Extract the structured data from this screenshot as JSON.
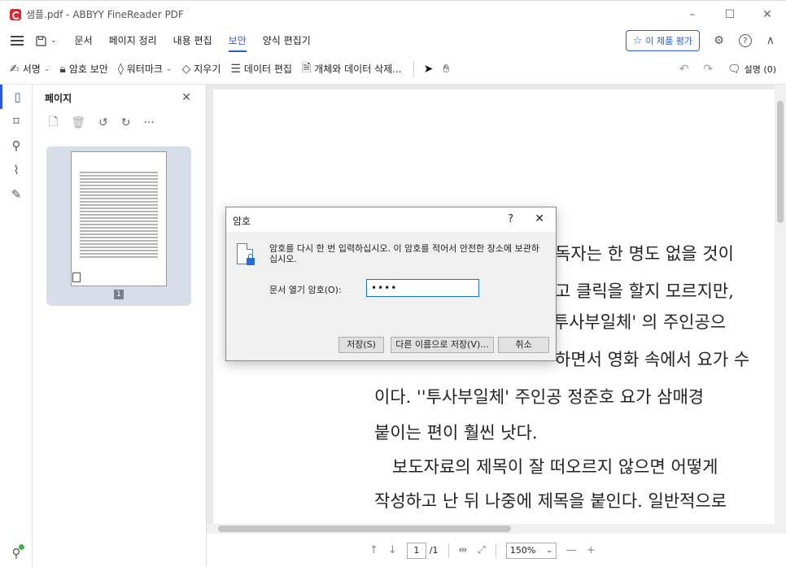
{
  "window": {
    "title": "샘플.pdf - ABBYY FineReader PDF",
    "minimize": "–",
    "maximize": "☐",
    "close": "✕"
  },
  "menu": {
    "file_icon": "save-icon",
    "tabs": [
      "문서",
      "페이지 정리",
      "내용 편집",
      "보안",
      "양식 편집기"
    ],
    "active_tab": "보안",
    "rate_label": "이 제품 평가",
    "settings_glyph": "⚙",
    "help_glyph": "?",
    "collapse_glyph": "∧"
  },
  "toolbar": {
    "signature": "서명",
    "password_security": "암호 보안",
    "watermark": "워터마크",
    "erase": "지우기",
    "redact_data": "데이터 편집",
    "delete_objects": "개체와 데이터 삭제...",
    "notes": "설명 (0)"
  },
  "pages_panel": {
    "title": "페이지",
    "page_number": "1"
  },
  "document": {
    "lines": [
      "독자는 한 명도 없을 것이",
      "고 클릭을 할지 모르지만,",
      "'투사부일체' 의 주인공으",
      "하면서 영화 속에서 요가 수",
      "이다. ''투사부일체' 주인공 정준호 요가 삼매경",
      "붙이는 편이 훨씬 낫다.",
      "보도자료의 제목이 잘 떠오르지 않으면 어떻게",
      "작성하고 난 뒤 나중에 제목을 붙인다. 일반적으로"
    ]
  },
  "statusbar": {
    "page_current": "1",
    "page_total": "/1",
    "zoom": "150%"
  },
  "dialog": {
    "title": "암호",
    "help": "?",
    "close": "✕",
    "message": "암호를 다시 한 번 입력하십시오. 이 암호를 적어서 안전한 장소에 보관하십시오.",
    "field_label": "문서 열기 암호(O):",
    "field_value": "••••",
    "save_button": "저장(S)",
    "save_as_button": "다른 이름으로 저장(V)...",
    "cancel_button": "취소"
  }
}
